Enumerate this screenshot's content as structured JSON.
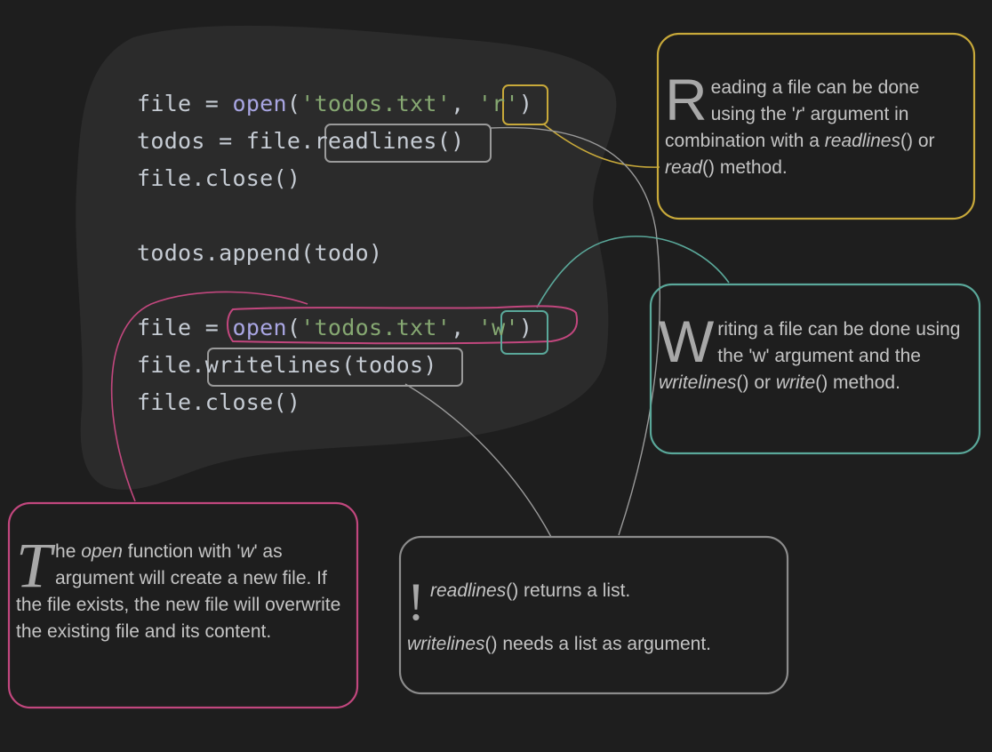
{
  "code": {
    "lines": [
      [
        {
          "t": "file",
          "k": "plain"
        },
        {
          "t": " = ",
          "k": "op"
        },
        {
          "t": "open",
          "k": "fn"
        },
        {
          "t": "(",
          "k": "punc"
        },
        {
          "t": "'todos.txt'",
          "k": "str"
        },
        {
          "t": ", ",
          "k": "punc"
        },
        {
          "t": "'r'",
          "k": "str"
        },
        {
          "t": ")",
          "k": "punc"
        }
      ],
      [
        {
          "t": "todos",
          "k": "plain"
        },
        {
          "t": " = ",
          "k": "op"
        },
        {
          "t": "file.readlines()",
          "k": "plain"
        }
      ],
      [
        {
          "t": "file.close()",
          "k": "plain"
        }
      ],
      [],
      [
        {
          "t": "todos.append(todo)",
          "k": "plain"
        }
      ],
      [],
      [
        {
          "t": "file",
          "k": "plain"
        },
        {
          "t": " = ",
          "k": "op"
        },
        {
          "t": "open",
          "k": "fn"
        },
        {
          "t": "(",
          "k": "punc"
        },
        {
          "t": "'todos.txt'",
          "k": "str"
        },
        {
          "t": ", ",
          "k": "punc"
        },
        {
          "t": "'w'",
          "k": "str"
        },
        {
          "t": ")",
          "k": "punc"
        }
      ],
      [
        {
          "t": "file.writelines(todos)",
          "k": "plain"
        }
      ],
      [
        {
          "t": "file.close()",
          "k": "plain"
        }
      ]
    ]
  },
  "notes": {
    "read": {
      "dropcap": "R",
      "rest_html": "eading a file can be done using the '<em>r</em>' argument in combination with a <em>readlines</em>() or <em>read</em>() method."
    },
    "write": {
      "dropcap": "W",
      "rest_html": "riting a file can be done using the 'w' argument and the <em>writelines</em>() or <em>write</em>() method."
    },
    "open": {
      "dropcap": "T",
      "rest_html": "he <em>open</em> function with '<em>w</em>' as argument will create a new file. If the file exists, the new file will overwrite the existing file and its content."
    },
    "list": {
      "mark": "!",
      "line1_html": "<em>readlines</em>() returns a list.",
      "line2_html": "<em>writelines</em>() needs a list as argument."
    }
  },
  "colors": {
    "background": "#1e1e1e",
    "code_panel": "#2b2b2b",
    "read_accent": "#c8a93a",
    "write_accent": "#5aa89a",
    "open_accent": "#c2477e",
    "neutral_accent": "#8c8c8c",
    "code_text": "#c6ccd4",
    "code_function": "#a9a6e3",
    "code_string": "#86a872",
    "note_text": "#c4c4c4"
  }
}
